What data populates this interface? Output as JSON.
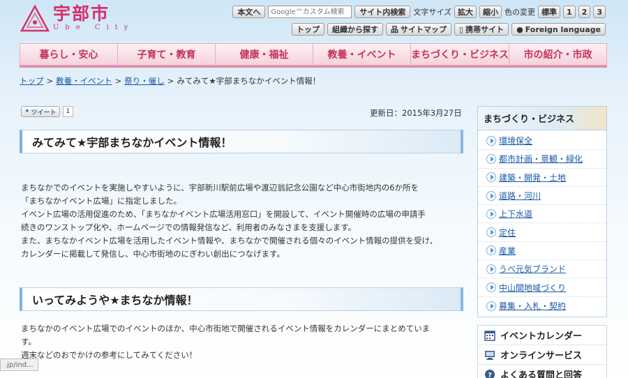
{
  "header": {
    "logo_jp": "宇部市",
    "logo_en": "Ube City",
    "honbun_label": "本文へ",
    "search_placeholder": "Google™カスタム検索",
    "search_button": "サイト内検索",
    "font_size_label": "文字サイズ",
    "font_large": "拡大",
    "font_small": "縮小",
    "color_label": "色の変更",
    "color_standard": "標準",
    "color_1": "1",
    "color_2": "2",
    "color_3": "3",
    "top_button": "トップ",
    "org_search_button": "組織から探す",
    "sitemap_button": "サイトマップ",
    "mobile_button": "携帯サイト",
    "foreign_button": "Foreign language"
  },
  "gnav": [
    {
      "label": "暮らし・安心"
    },
    {
      "label": "子育て・教育"
    },
    {
      "label": "健康・福祉"
    },
    {
      "label": "教養・イベント"
    },
    {
      "label": "まちづくり・ビジネス"
    },
    {
      "label": "市の紹介・市政"
    }
  ],
  "breadcrumb": {
    "items": [
      "トップ",
      "教養・イベント",
      "祭り・催し"
    ],
    "sep": ">",
    "current": "みてみて★宇部まちなかイベント情報！"
  },
  "tweet": {
    "label": "ツイート",
    "count": "1"
  },
  "updated": "更新日：2015年3月27日",
  "main": {
    "title": "みてみて★宇部まちなかイベント情報！",
    "para1": [
      "まちなかでのイベントを実施しやすいように、宇部新川駅前広場や渡辺翁記念公園など中心市街地内の6か所を",
      "「まちなかイベント広場」に指定しました。",
      "イベント広場の活用促進のため、「まちなかイベント広場活用窓口」を開設して、イベント開催時の広場の申請手",
      "続きのワンストップ化や、ホームページでの情報発信など、利用者のみなさまを支援します。",
      "また、まちなかイベント広場を活用したイベント情報や、まちなかで開催される個々のイベント情報の提供を受け、",
      "カレンダーに掲載して発信し、中心市街地のにぎわい創出につなげます。"
    ],
    "subtitle": "いってみようや★まちなか情報！",
    "para2": [
      "まちなかのイベント広場でのイベントのほか、中心市街地で開催されるイベント情報をカレンダーにまとめていま",
      "す。",
      "週末などのおでかけの参考にしてみてください！"
    ]
  },
  "sidebar": {
    "heading": "まちづくり・ビジネス",
    "items": [
      {
        "label": "環境保全"
      },
      {
        "label": "都市計画・景観・緑化"
      },
      {
        "label": "建築・開発・土地"
      },
      {
        "label": "道路・河川"
      },
      {
        "label": "上下水道"
      },
      {
        "label": "定住"
      },
      {
        "label": "産業"
      },
      {
        "label": "うべ元気ブランド"
      },
      {
        "label": "中山間地域づくり"
      },
      {
        "label": "募集・入札・契約"
      }
    ],
    "links": [
      {
        "label": "イベントカレンダー",
        "icon": "calendar-icon"
      },
      {
        "label": "オンラインサービス",
        "icon": "computer-icon"
      },
      {
        "label": "よくある質問と回答",
        "icon": "question-icon"
      }
    ]
  },
  "status_url": ".jp/ind..."
}
